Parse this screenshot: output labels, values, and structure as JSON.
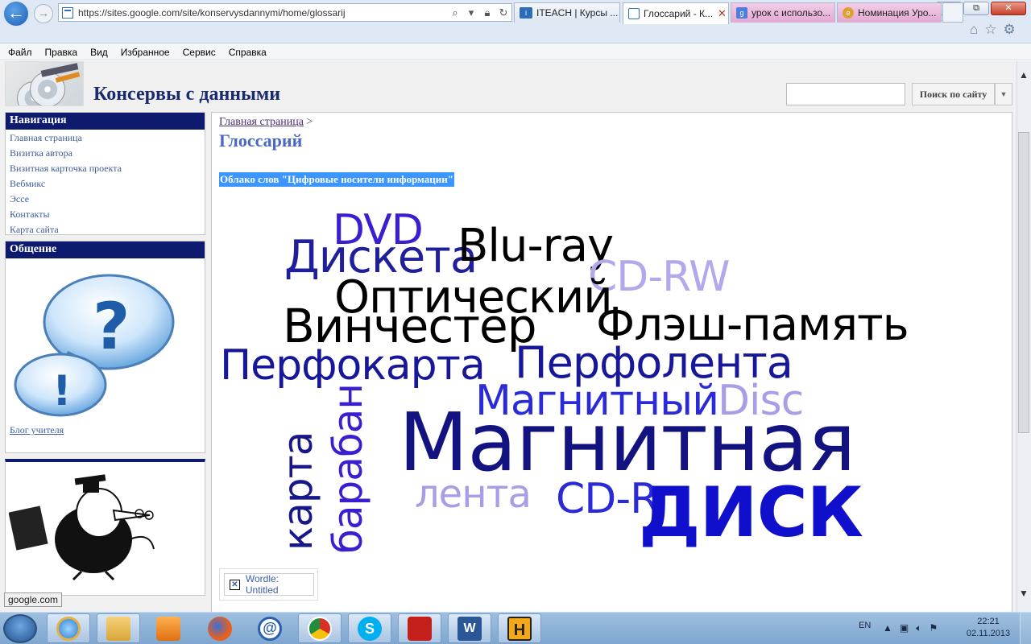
{
  "browser": {
    "url": "https://sites.google.com/site/konservysdannymi/home/glossarij",
    "tabs": [
      {
        "label": "ITEACH | Курсы ..."
      },
      {
        "label": "Глоссарий - К..."
      },
      {
        "label": "урок с использо..."
      },
      {
        "label": "Номинация Уро..."
      }
    ],
    "window_buttons": {
      "minimize": "▭",
      "restore": "⧉",
      "close": "✕"
    }
  },
  "menu": {
    "items": [
      "Файл",
      "Правка",
      "Вид",
      "Избранное",
      "Сервис",
      "Справка"
    ]
  },
  "site": {
    "title": "Консервы с данными",
    "search_button": "Поиск по сайту",
    "navigation": {
      "header": "Навигация",
      "items": [
        "Главная страница",
        "Визитка автора",
        "Визитная карточка проекта",
        "Вебмикс",
        "Эссе",
        "Контакты",
        "Карта сайта"
      ]
    },
    "communication": {
      "header": "Общение",
      "blog_link": "Блог учителя"
    }
  },
  "content": {
    "breadcrumb": "Главная страница",
    "breadcrumb_sep": ">",
    "page_title": "Глоссарий",
    "cloud_heading": "Облако слов \"Цифровые носители информации\"",
    "wordle_link": "Wordle: Untitled",
    "word_cloud": [
      {
        "text": "DVD",
        "color": "#3a1fd0"
      },
      {
        "text": "Дискета",
        "color": "#1f1f9a"
      },
      {
        "text": "Blu-ray",
        "color": "#000000"
      },
      {
        "text": "CD-RW",
        "color": "#b3a8ec"
      },
      {
        "text": "Оптический",
        "color": "#000000"
      },
      {
        "text": "Винчестер",
        "color": "#000000"
      },
      {
        "text": "Флэш-память",
        "color": "#000000"
      },
      {
        "text": "Перфокарта",
        "color": "#17179a"
      },
      {
        "text": "Перфолента",
        "color": "#17179a"
      },
      {
        "text": "Магнитный",
        "color": "#2a2ad8"
      },
      {
        "text": "Disc",
        "color": "#a99ee6"
      },
      {
        "text": "карта",
        "color": "#17178a"
      },
      {
        "text": "барабан",
        "color": "#3a1fd0"
      },
      {
        "text": "Магнитная",
        "color": "#121280"
      },
      {
        "text": "лента",
        "color": "#a99ee6"
      },
      {
        "text": "CD-R",
        "color": "#2a2ad8"
      },
      {
        "text": "ДИСК",
        "color": "#1010cc"
      }
    ]
  },
  "status_tip": "google.com",
  "taskbar": {
    "language": "EN",
    "time": "22:21",
    "date": "02.11.2013"
  },
  "colors": {
    "nav_header_bg": "#0d1a6e",
    "site_title": "#1a2a6e",
    "page_title": "#4a67c4",
    "link": "#3e5d9a",
    "highlight": "#3b97ff"
  }
}
